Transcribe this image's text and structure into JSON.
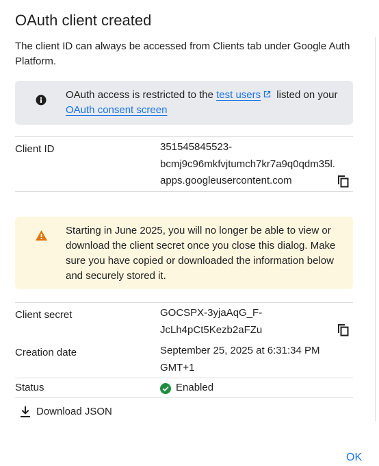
{
  "dialog": {
    "title": "OAuth client created",
    "intro": "The client ID can always be accessed from Clients tab under Google Auth Platform."
  },
  "info_notice": {
    "icon": "info-icon",
    "text_before": "OAuth access is restricted to the ",
    "link_test_users": "test users",
    "text_middle": " listed on your ",
    "link_consent_screen": "OAuth consent screen"
  },
  "client_id": {
    "label": "Client ID",
    "value": "351545845523-\nbcmj9c96mkfvjtumch7kr7a9q0qdm35l.\napps.googleusercontent.com",
    "copy_icon": "copy-icon"
  },
  "warning_notice": {
    "icon": "warning-icon",
    "text": "Starting in June 2025, you will no longer be able to view or download the client secret once you close this dialog. Make sure you have copied or downloaded the information below and securely stored it."
  },
  "client_secret": {
    "label": "Client secret",
    "value": "GOCSPX-3yjaAqG_F-\nJcLh4pCt5Kezb2aFZu",
    "copy_icon": "copy-icon"
  },
  "creation_date": {
    "label": "Creation date",
    "value": "September 25, 2025 at 6:31:34 PM\nGMT+1"
  },
  "status": {
    "label": "Status",
    "value": "Enabled",
    "icon": "check-circle-icon",
    "color": "#1e8e3e"
  },
  "actions": {
    "download_label": "Download JSON",
    "download_icon": "download-icon",
    "ok_label": "OK"
  },
  "colors": {
    "accent": "#1a73e8",
    "info_bg": "#e8eaed",
    "warning_bg": "#fef7e0",
    "warning_icon": "#e37400",
    "divider": "#dadce0"
  }
}
